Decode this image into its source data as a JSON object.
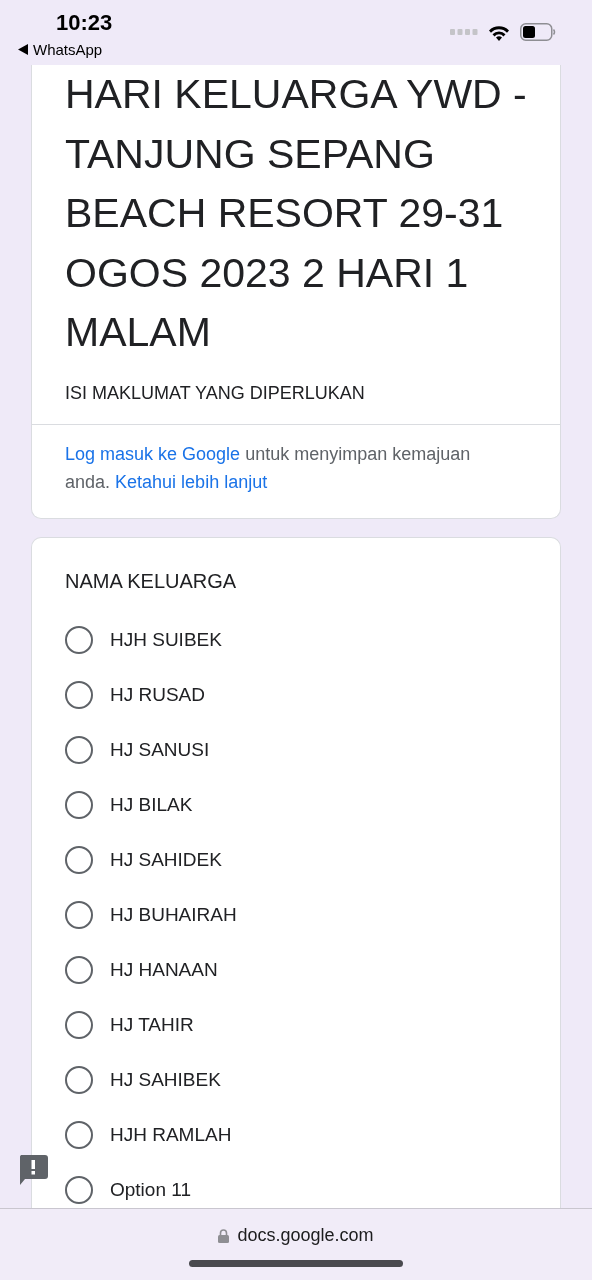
{
  "status_bar": {
    "time": "10:23",
    "back_app": "WhatsApp"
  },
  "header_card": {
    "title": "HARI KELUARGA YWD - TANJUNG SEPANG BEACH RESORT 29-31 OGOS 2023 2 HARI 1 MALAM",
    "description": "ISI MAKLUMAT YANG DIPERLUKAN",
    "signin_notice": [
      {
        "kind": "link",
        "text": "Log masuk ke Google"
      },
      {
        "kind": "text",
        "text": "untuk menyimpan kemajuan anda."
      },
      {
        "kind": "link",
        "text": "Ketahui lebih lanjut"
      }
    ]
  },
  "question": {
    "title": "NAMA KELUARGA",
    "options": [
      {
        "label": "HJH SUIBEK",
        "selected": false
      },
      {
        "label": "HJ RUSAD",
        "selected": false
      },
      {
        "label": "HJ SANUSI",
        "selected": false
      },
      {
        "label": "HJ BILAK",
        "selected": false
      },
      {
        "label": "HJ SAHIDEK",
        "selected": false
      },
      {
        "label": "HJ BUHAIRAH",
        "selected": false
      },
      {
        "label": "HJ HANAAN",
        "selected": false
      },
      {
        "label": "HJ TAHIR",
        "selected": false
      },
      {
        "label": "HJ SAHIBEK",
        "selected": false
      },
      {
        "label": "HJH RAMLAH",
        "selected": false
      },
      {
        "label": "Option 11",
        "selected": false
      }
    ]
  },
  "browser_bar": {
    "url": "docs.google.com"
  }
}
